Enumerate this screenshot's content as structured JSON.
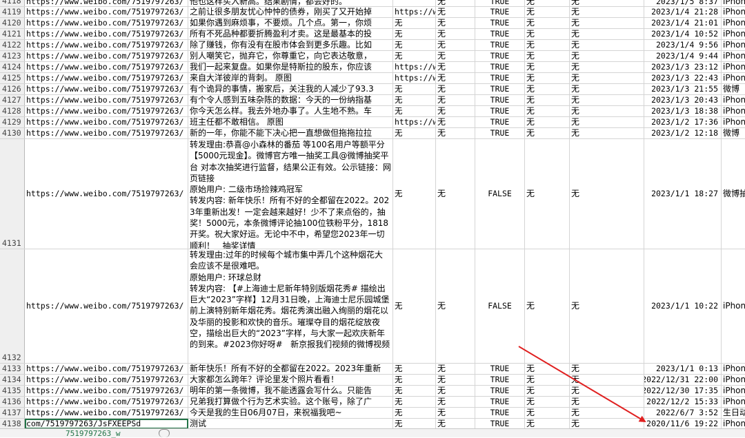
{
  "sheet": {
    "url_full": "https://www.weibo.com/7519797263/",
    "rows": [
      {
        "num": "4118",
        "url": "https://www.weibo.com/7519797263/",
        "text": "他也这样买入新高。结果剧情，都会好的。",
        "src": "",
        "a": "无",
        "b": "无",
        "flag": "TRUE",
        "d": "无",
        "e": "无",
        "time": "2023/1/5 8:37",
        "client": "iPhone"
      },
      {
        "num": "4119",
        "url": "https://www.weibo.com/7519797263/",
        "text": "之前让很多朋友忧心忡忡的债券，刚买了又开始掉",
        "src": "https://w",
        "a": "无",
        "b": "无",
        "flag": "TRUE",
        "d": "无",
        "e": "无",
        "time": "2023/1/4 21:28",
        "client": "iPhone"
      },
      {
        "num": "4120",
        "url": "https://www.weibo.com/7519797263/",
        "text": "如果你遇到麻烦事，不要烦。几个点。第一，你烦",
        "src": "无",
        "a": "无",
        "b": "无",
        "flag": "TRUE",
        "d": "无",
        "e": "无",
        "time": "2023/1/4 21:01",
        "client": "iPhone"
      },
      {
        "num": "4121",
        "url": "https://www.weibo.com/7519797263/",
        "text": "所有不死品种都要折腾盈利才卖。这是最基本的投",
        "src": "无",
        "a": "无",
        "b": "无",
        "flag": "TRUE",
        "d": "无",
        "e": "无",
        "time": "2023/1/4 10:52",
        "client": "iPhone"
      },
      {
        "num": "4122",
        "url": "https://www.weibo.com/7519797263/",
        "text": "除了赚钱，你有没有在股市体会到更多乐趣。比如",
        "src": "无",
        "a": "无",
        "b": "无",
        "flag": "TRUE",
        "d": "无",
        "e": "无",
        "time": "2023/1/4 9:56",
        "client": "iPhone"
      },
      {
        "num": "4123",
        "url": "https://www.weibo.com/7519797263/",
        "text": "别人嘲笑它，抛弃它，你尊重它，向它表达敬意，",
        "src": "无",
        "a": "无",
        "b": "无",
        "flag": "TRUE",
        "d": "无",
        "e": "无",
        "time": "2023/1/4 9:44",
        "client": "iPhone"
      },
      {
        "num": "4124",
        "url": "https://www.weibo.com/7519797263/",
        "text": "我们一起来复盘。如果你是特斯拉的股东，你应该",
        "src": "https://w",
        "a": "无",
        "b": "无",
        "flag": "TRUE",
        "d": "无",
        "e": "无",
        "time": "2023/1/3 23:12",
        "client": "iPhone"
      },
      {
        "num": "4125",
        "url": "https://www.weibo.com/7519797263/",
        "text": "来自大洋彼岸的背刺。   原图",
        "src": "https://w",
        "a": "无",
        "b": "无",
        "flag": "TRUE",
        "d": "无",
        "e": "无",
        "time": "2023/1/3 22:43",
        "client": "iPhone"
      },
      {
        "num": "4126",
        "url": "https://www.weibo.com/7519797263/",
        "text": "有个诡异的事情，搬家后，关注我的人减少了93.3",
        "src": "无",
        "a": "无",
        "b": "无",
        "flag": "TRUE",
        "d": "无",
        "e": "无",
        "time": "2023/1/3 21:55",
        "client": "微博"
      },
      {
        "num": "4127",
        "url": "https://www.weibo.com/7519797263/",
        "text": "有个令人感到五味杂陈的数据：今天的一份纳指基",
        "src": "无",
        "a": "无",
        "b": "无",
        "flag": "TRUE",
        "d": "无",
        "e": "无",
        "time": "2023/1/3 20:43",
        "client": "iPhone"
      },
      {
        "num": "4128",
        "url": "https://www.weibo.com/7519797263/",
        "text": "你今天怎么样。我去外地办事了。人生地不熟。车",
        "src": "无",
        "a": "无",
        "b": "无",
        "flag": "TRUE",
        "d": "无",
        "e": "无",
        "time": "2023/1/3 18:38",
        "client": "iPhone"
      },
      {
        "num": "4129",
        "url": "https://www.weibo.com/7519797263/",
        "text": "班主任都不敢相信。   原图",
        "src": "https://w",
        "a": "无",
        "b": "无",
        "flag": "TRUE",
        "d": "无",
        "e": "无",
        "time": "2023/1/2 17:36",
        "client": "iPhone"
      },
      {
        "num": "4130",
        "url": "https://www.weibo.com/7519797263/",
        "text": "新的一年，你能不能下决心把一直想做但拖拖拉拉",
        "src": "无",
        "a": "无",
        "b": "无",
        "flag": "TRUE",
        "d": "无",
        "e": "无",
        "time": "2023/1/2 12:18",
        "client": "微博"
      },
      {
        "num": "4131",
        "url": "https://www.weibo.com/7519797263/",
        "text": "转发理由:恭喜@小森林的番茄 等100名用户等额平分【5000元现金】。微博官方唯一抽奖工具@微博抽奖平台 对本次抽奖进行监督，结果公正有效。公示链接：网页链接\n原始用户: 二级市场捡辣鸡冠军\n转发内容: 新年快乐！所有不好的全都留在2022。2023年重新出发！一定会越来越好！少不了来点俗的，抽奖！5000元，本条微博评论抽100位铁粉平分，1818开奖。祝大家好运。无论中不中，希望您2023年一切顺利！   抽奖详情",
        "src": "无",
        "a": "无",
        "b": "无",
        "flag": "FALSE",
        "d": "无",
        "e": "无",
        "time": "2023/1/1 18:27",
        "client": "微博抽奖"
      },
      {
        "num": "4132",
        "url": "https://www.weibo.com/7519797263/",
        "text": "转发理由:过年的时候每个城市集中弄几个这种烟花大会应该不是很难吧。\n原始用户: 环球总财\n转发内容: 【#上海迪士尼新年特别版烟花秀# 描绘出巨大“2023”字样】12月31日晚，上海迪士尼乐园城堡前上演特别新年烟花秀。烟花秀演出融入绚丽的烟花以及华丽的投影和欢快的音乐。璀璨夺目的烟花绽放夜空，描绘出巨大的“2023”字样，与大家一起欢庆新年的到来。#2023你好呀#   新京报我们视频的微博视频",
        "src": "无",
        "a": "无",
        "b": "无",
        "flag": "FALSE",
        "d": "无",
        "e": "无",
        "time": "2023/1/1 10:22",
        "client": "iPhone"
      },
      {
        "num": "4133",
        "url": "https://www.weibo.com/7519797263/",
        "text": "新年快乐！所有不好的全都留在2022。2023年重新",
        "src": "无",
        "a": "无",
        "b": "无",
        "flag": "TRUE",
        "d": "无",
        "e": "无",
        "time": "2023/1/1 0:13",
        "client": "iPhone"
      },
      {
        "num": "4134",
        "url": "https://www.weibo.com/7519797263/",
        "text": "大家都怎么跨年？评论里发个照片看看！",
        "src": "无",
        "a": "无",
        "b": "无",
        "flag": "TRUE",
        "d": "无",
        "e": "无",
        "time": "2022/12/31 22:00",
        "client": "iPhone"
      },
      {
        "num": "4135",
        "url": "https://www.weibo.com/7519797263/",
        "text": "明年的第一条微博，我不能透露会写什么。只能告",
        "src": "无",
        "a": "无",
        "b": "无",
        "flag": "TRUE",
        "d": "无",
        "e": "无",
        "time": "2022/12/30 17:35",
        "client": "iPhone"
      },
      {
        "num": "4136",
        "url": "https://www.weibo.com/7519797263/",
        "text": "兄弟我打算做个行为艺术实验。这个账号，除了广",
        "src": "无",
        "a": "无",
        "b": "无",
        "flag": "TRUE",
        "d": "无",
        "e": "无",
        "time": "2022/12/2 15:33",
        "client": "iPhone"
      },
      {
        "num": "4137",
        "url": "https://www.weibo.com/7519797263/",
        "text": "今天是我的生日06月07日，来祝福我吧~",
        "src": "无",
        "a": "无",
        "b": "无",
        "flag": "TRUE",
        "d": "无",
        "e": "无",
        "time": "2022/6/7 3:52",
        "client": "生日动"
      },
      {
        "num": "4138",
        "url": "com/7519797263/JsFXEEPSd",
        "text": "测试",
        "src": "无",
        "a": "无",
        "b": "无",
        "flag": "TRUE",
        "d": "无",
        "e": "无",
        "time": "2020/11/6 19:22",
        "client": "iPhone"
      }
    ]
  },
  "tabbar": {
    "sheet_tab": "7519797263_w"
  },
  "colors": {
    "grid": "#d4d4d4",
    "header_bg": "#efefef",
    "selection": "#217346",
    "arrow": "#e02020"
  }
}
